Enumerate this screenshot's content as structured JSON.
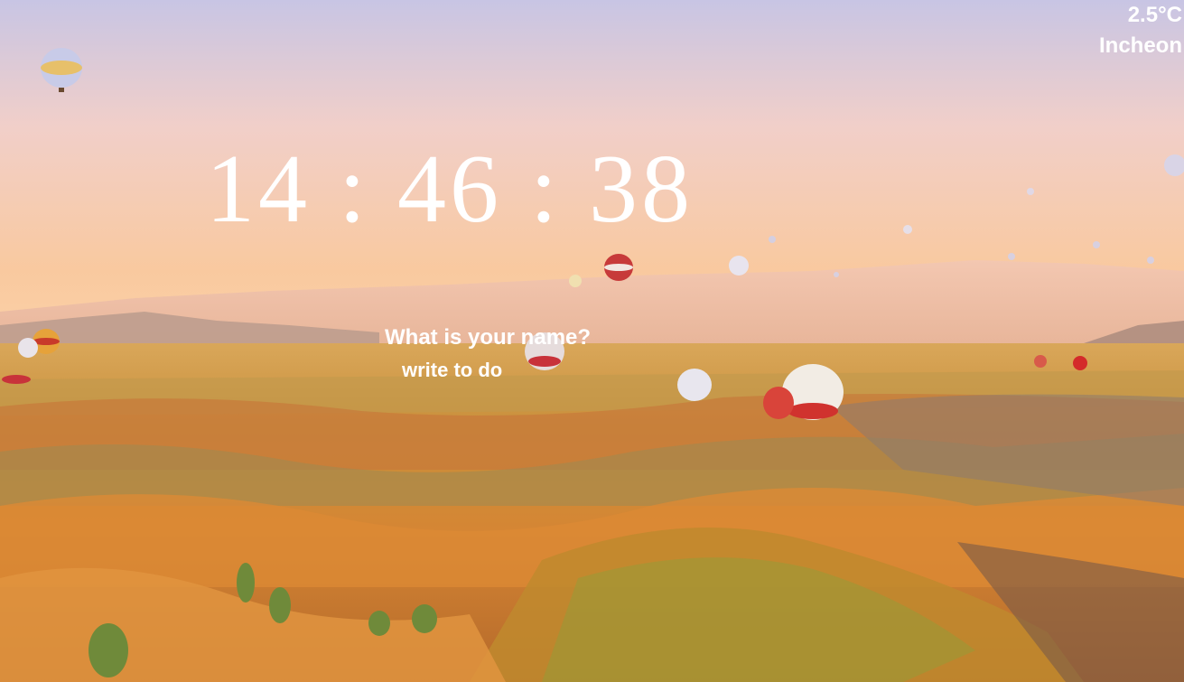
{
  "weather": {
    "temperature": "2.5°C",
    "city": "Incheon"
  },
  "clock": {
    "time": "14 : 46 : 38"
  },
  "greeting": {
    "placeholder": "What is your name?"
  },
  "todo": {
    "placeholder": "write to do"
  },
  "colors": {
    "text": "#ffffff",
    "sky_top": "#c9c6e3",
    "sky_horizon": "#f7c9a0",
    "land": "#d9892f"
  }
}
